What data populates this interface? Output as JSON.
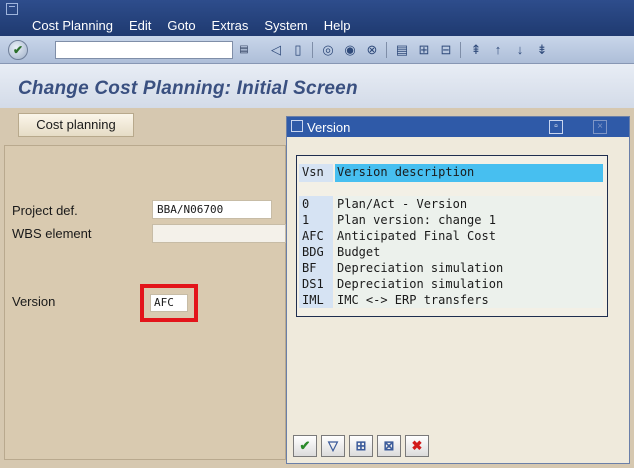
{
  "menubar": {
    "items": [
      "Cost Planning",
      "Edit",
      "Goto",
      "Extras",
      "System",
      "Help"
    ]
  },
  "toolbar": {
    "ok_icon": "checkmark-icon",
    "command_value": "",
    "icons": [
      "back-icon",
      "save-icon",
      "navigate-back-icon",
      "exit-icon",
      "cancel-icon",
      "print-icon",
      "find-icon",
      "find-next-icon",
      "first-page-icon",
      "prev-page-icon",
      "next-page-icon",
      "last-page-icon"
    ]
  },
  "title": "Change Cost Planning: Initial Screen",
  "cost_planning_button": "Cost planning",
  "form": {
    "project_def_label": "Project def.",
    "project_def_value": "BBA/N06700",
    "wbs_label": "WBS element",
    "wbs_value": "",
    "version_label": "Version",
    "version_value": "AFC"
  },
  "dialog": {
    "title": "Version",
    "header": {
      "key": "Vsn",
      "desc": "Version description"
    },
    "rows": [
      {
        "key": "0",
        "desc": "Plan/Act - Version"
      },
      {
        "key": "1",
        "desc": "Plan version: change 1"
      },
      {
        "key": "AFC",
        "desc": "Anticipated Final Cost"
      },
      {
        "key": "BDG",
        "desc": "Budget"
      },
      {
        "key": "BF",
        "desc": "Depreciation simulation"
      },
      {
        "key": "DS1",
        "desc": "Depreciation simulation"
      },
      {
        "key": "IML",
        "desc": "IMC <-> ERP transfers"
      }
    ],
    "footer_buttons": [
      "confirm-icon",
      "filter-icon",
      "sort-icon",
      "find-icon",
      "cancel-icon"
    ]
  },
  "colors": {
    "highlight_border": "#e3141a",
    "header_accent": "#47bff0",
    "title_text": "#3a5080"
  }
}
